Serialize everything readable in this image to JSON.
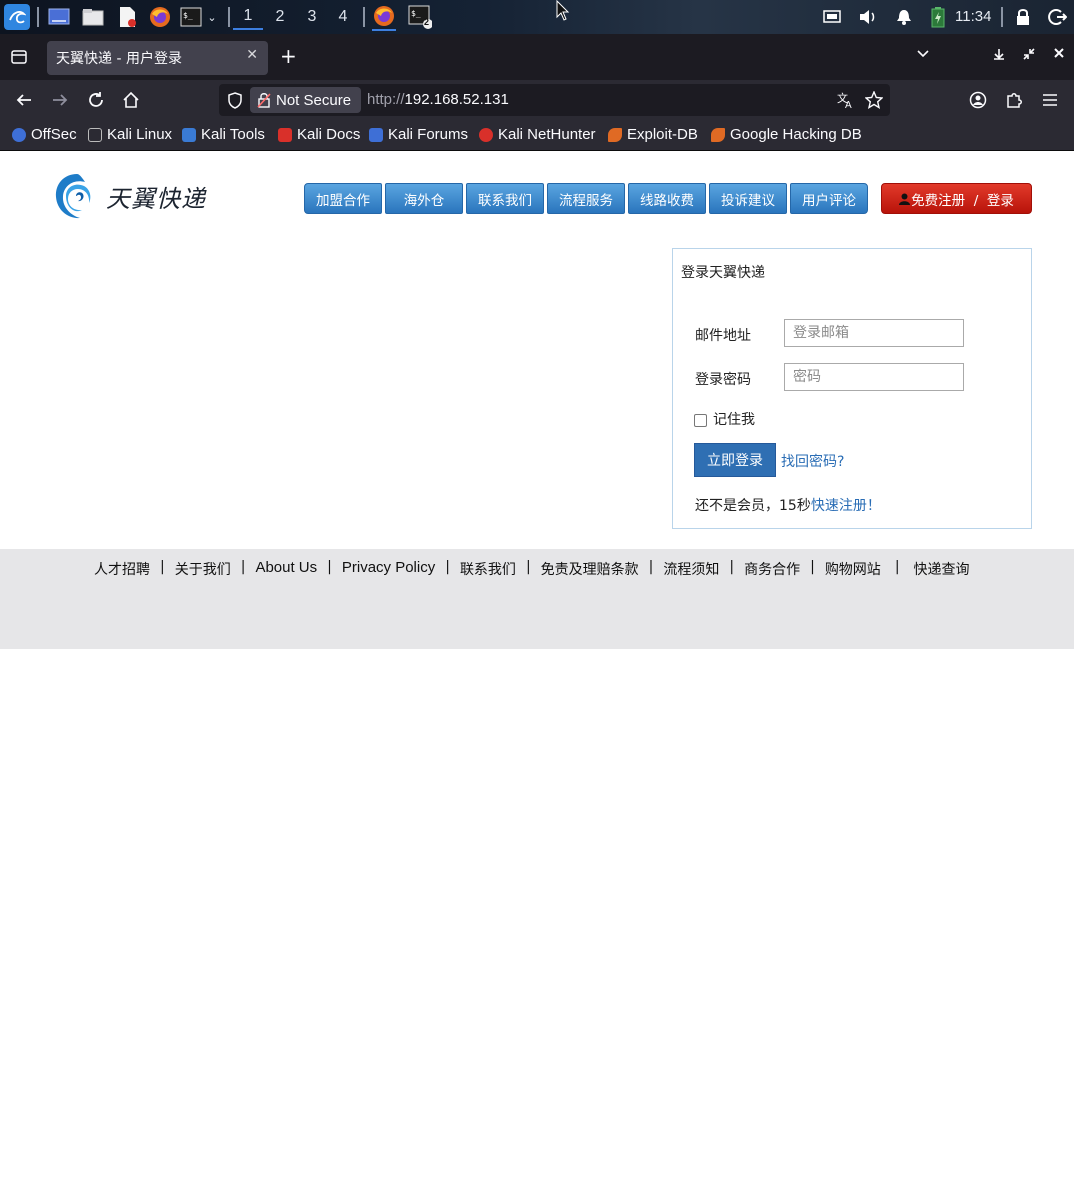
{
  "taskbar": {
    "workspaces": [
      "1",
      "2",
      "3",
      "4"
    ],
    "active_workspace": "1",
    "terminal_badge": "2",
    "clock": "11:34",
    "icons": [
      "kali-menu-icon",
      "desktop-icon",
      "file-manager-icon",
      "text-editor-icon",
      "firefox-icon",
      "terminal-icon",
      "firefox-window-icon",
      "terminal-window-icon",
      "display-icon",
      "volume-icon",
      "notification-icon",
      "battery-icon",
      "lock-icon",
      "logout-icon"
    ]
  },
  "browser": {
    "tab_title": "天翼快递 - 用户登录",
    "security_label": "Not Secure",
    "url_protocol": "http://",
    "url_host": "192.168.52.131",
    "bookmarks": [
      {
        "label": "OffSec",
        "color": "#3e6fd6"
      },
      {
        "label": "Kali Linux",
        "color": "#2b2a33"
      },
      {
        "label": "Kali Tools",
        "color": "#3a7bd5"
      },
      {
        "label": "Kali Docs",
        "color": "#d9302a"
      },
      {
        "label": "Kali Forums",
        "color": "#3e6fd6"
      },
      {
        "label": "Kali NetHunter",
        "color": "#d9302a"
      },
      {
        "label": "Exploit-DB",
        "color": "#e06a24"
      },
      {
        "label": "Google Hacking DB",
        "color": "#e06a24"
      }
    ]
  },
  "site": {
    "logo_text": "天翼快递",
    "menu": [
      "加盟合作",
      "海外仓",
      "联系我们",
      "流程服务",
      "线路收费",
      "投诉建议",
      "用户评论"
    ],
    "register_button": "免费注册  /  登录",
    "brand_colors": {
      "menu": "#2a75bd",
      "register": "#c81e12"
    }
  },
  "login": {
    "title": "登录天翼快递",
    "email_label": "邮件地址",
    "email_placeholder": "登录邮箱",
    "password_label": "登录密码",
    "password_placeholder": "密码",
    "remember_label": "记住我",
    "remember_checked": false,
    "submit_label": "立即登录",
    "forgot_link": "找回密码?",
    "signup_prefix": "还不是会员，15秒",
    "signup_link": "快速注册！"
  },
  "footer": {
    "links": [
      "人才招聘",
      "关于我们",
      "About Us",
      "Privacy Policy",
      "联系我们",
      "免责及理赔条款",
      "流程须知",
      "商务合作",
      "购物网站",
      "快递查询"
    ],
    "separator": "|"
  }
}
